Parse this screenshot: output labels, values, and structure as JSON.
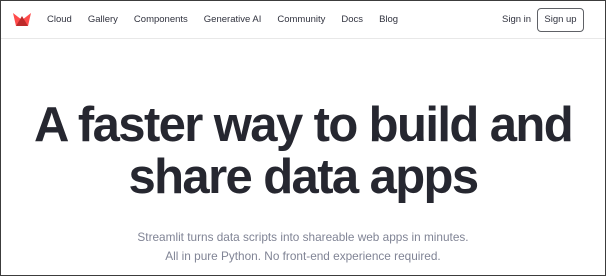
{
  "nav": {
    "logo_icon": "streamlit-crown-logo",
    "brand_color": "#ff4b4b",
    "links": [
      "Cloud",
      "Gallery",
      "Components",
      "Generative AI",
      "Community",
      "Docs",
      "Blog"
    ],
    "sign_in_label": "Sign in",
    "sign_up_label": "Sign up"
  },
  "hero": {
    "title_line1": "A faster way to build and",
    "title_line2": "share data apps",
    "subtitle_line1": "Streamlit turns data scripts into shareable web apps in minutes.",
    "subtitle_line2": "All in pure Python. No front-end experience required."
  }
}
